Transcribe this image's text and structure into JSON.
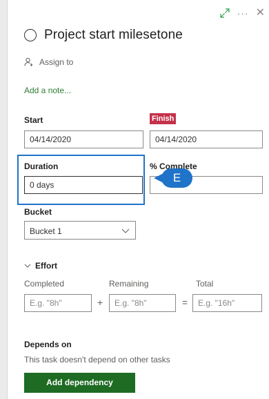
{
  "title": "Project start milesetone",
  "assign": {
    "label": "Assign to"
  },
  "note": {
    "link": "Add a note..."
  },
  "dates": {
    "start_label": "Start",
    "start_value": "04/14/2020",
    "finish_label": "Finish",
    "finish_value": "04/14/2020"
  },
  "duration": {
    "label": "Duration",
    "value": "0 days"
  },
  "percent_complete": {
    "label": "% Complete",
    "value": ""
  },
  "callout": {
    "text": "E"
  },
  "bucket": {
    "label": "Bucket",
    "value": "Bucket 1"
  },
  "effort": {
    "toggle_label": "Effort",
    "completed_label": "Completed",
    "completed_placeholder": "E.g. \"8h\"",
    "remaining_label": "Remaining",
    "remaining_placeholder": "E.g. \"8h\"",
    "total_label": "Total",
    "total_placeholder": "E.g. \"16h\"",
    "plus": "+",
    "equals": "="
  },
  "depends": {
    "title": "Depends on",
    "desc": "This task doesn't depend on other tasks",
    "button": "Add dependency"
  },
  "colors": {
    "finish_badge": "#c4314b",
    "link_green": "#2e7d32",
    "button_green": "#1e6b24",
    "highlight_blue": "#1f73c9"
  }
}
